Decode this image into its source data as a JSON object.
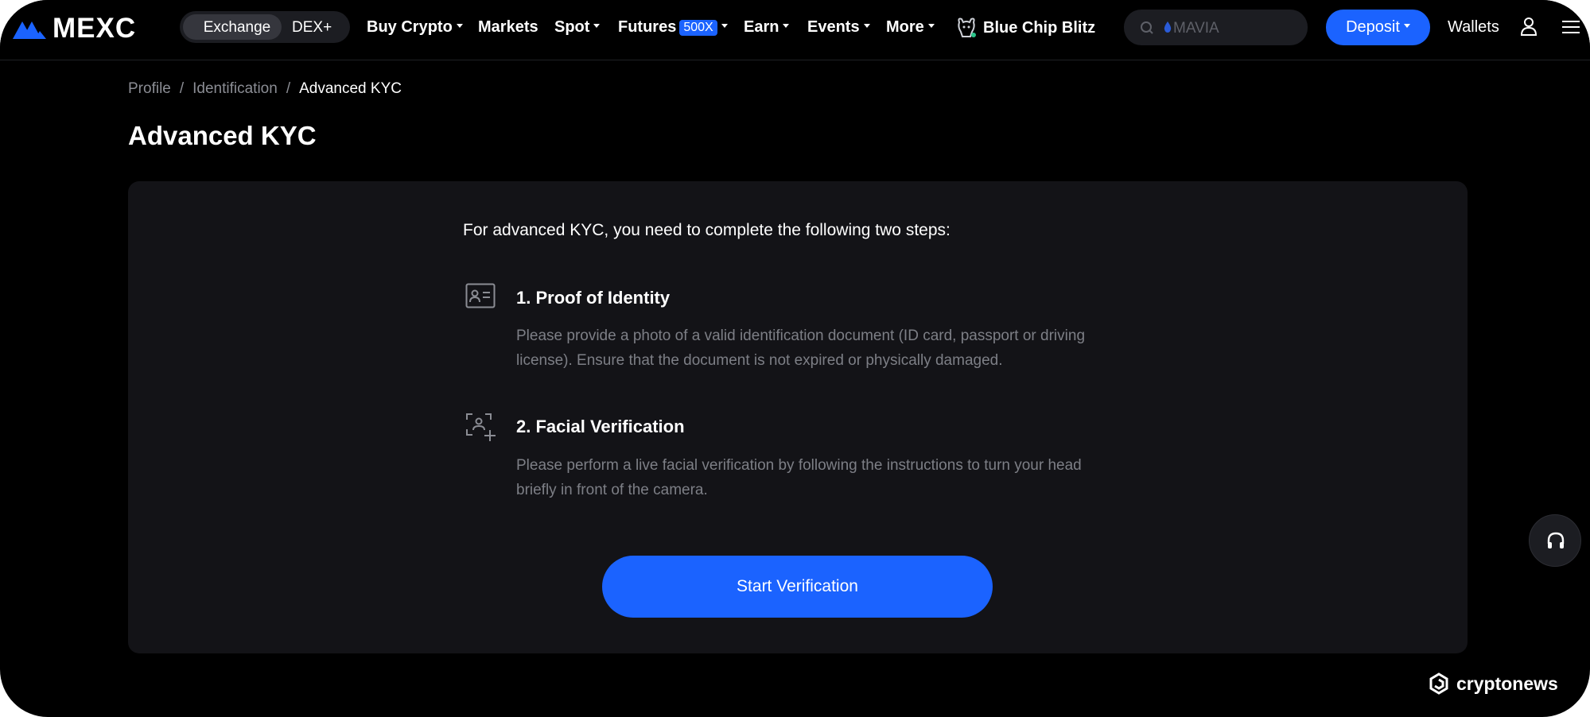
{
  "nav": {
    "logo_text": "MEXC",
    "switch": {
      "exchange": "Exchange",
      "dex": "DEX+"
    },
    "items": {
      "buy_crypto": "Buy Crypto",
      "markets": "Markets",
      "spot": "Spot",
      "futures": "Futures",
      "futures_badge": "500X",
      "earn": "Earn",
      "events": "Events",
      "more": "More"
    },
    "promo": "Blue Chip Blitz",
    "search_placeholder": "MAVIA",
    "deposit": "Deposit",
    "wallets": "Wallets"
  },
  "breadcrumb": [
    "Profile",
    "Identification",
    "Advanced KYC"
  ],
  "page_title": "Advanced KYC",
  "card": {
    "intro": "For advanced KYC, you need to complete the following two steps:",
    "steps": [
      {
        "title": "1. Proof of Identity",
        "desc_line1": "Please provide a photo of a valid identification document (ID card, passport or driving",
        "desc_line2": "license). Ensure that the document is not expired or physically damaged.",
        "icon": "id-card-icon"
      },
      {
        "title": "2. Facial Verification",
        "desc_line1": "Please perform a live facial verification by following the instructions to turn your head",
        "desc_line2": "briefly in front of the camera.",
        "icon": "face-scan-icon"
      }
    ],
    "start_button": "Start Verification"
  },
  "watermark": "cryptonews",
  "colors": {
    "accent": "#1b63ff",
    "background": "#000000",
    "card": "#131317"
  }
}
